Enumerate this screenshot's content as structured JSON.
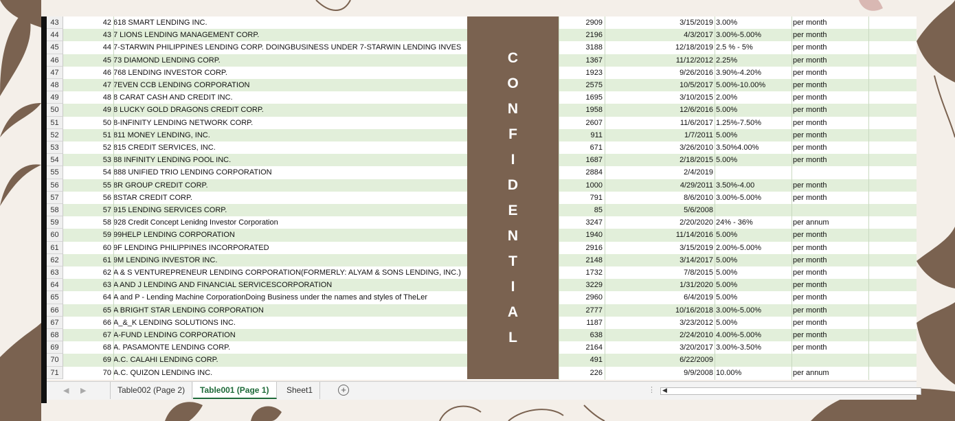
{
  "conf_letters": [
    "C",
    "O",
    "N",
    "F",
    "I",
    "D",
    "E",
    "N",
    "T",
    "I",
    "A",
    "L"
  ],
  "rows": [
    {
      "r": "43",
      "i": "42",
      "n": "618 SMART LENDING INC.",
      "c": "2909",
      "d": "3/15/2019",
      "rate": "3.00%",
      "per": "per month"
    },
    {
      "r": "44",
      "i": "43",
      "n": "7 LIONS LENDING MANAGEMENT CORP.",
      "c": "2196",
      "d": "4/3/2017",
      "rate": "3.00%-5.00%",
      "per": "per month"
    },
    {
      "r": "45",
      "i": "44",
      "n": "7-STARWIN PHILIPPINES LENDING CORP. DOINGBUSINESS UNDER 7-STARWIN LENDING INVES",
      "c": "3188",
      "d": "12/18/2019",
      "rate": "2.5 % - 5%",
      "per": "per month"
    },
    {
      "r": "46",
      "i": "45",
      "n": "73 DIAMOND LENDING CORP.",
      "c": "1367",
      "d": "11/12/2012",
      "rate": "2.25%",
      "per": "per month"
    },
    {
      "r": "47",
      "i": "46",
      "n": "768 LENDING INVESTOR CORP.",
      "c": "1923",
      "d": "9/26/2016",
      "rate": "3.90%-4.20%",
      "per": "per month"
    },
    {
      "r": "48",
      "i": "47",
      "n": "7EVEN CCB LENDING CORPORATION",
      "c": "2575",
      "d": "10/5/2017",
      "rate": "5.00%-10.00%",
      "per": "per month"
    },
    {
      "r": "49",
      "i": "48",
      "n": "8 CARAT CASH AND CREDIT INC.",
      "c": "1695",
      "d": "3/10/2015",
      "rate": "2.00%",
      "per": "per month"
    },
    {
      "r": "50",
      "i": "49",
      "n": "8 LUCKY GOLD DRAGONS CREDIT CORP.",
      "c": "1958",
      "d": "12/6/2016",
      "rate": "5.00%",
      "per": "per month"
    },
    {
      "r": "51",
      "i": "50",
      "n": "8-INFINITY LENDING NETWORK CORP.",
      "c": "2607",
      "d": "11/6/2017",
      "rate": "1.25%-7.50%",
      "per": "per month"
    },
    {
      "r": "52",
      "i": "51",
      "n": "811 MONEY LENDING, INC.",
      "c": "911",
      "d": "1/7/2011",
      "rate": "5.00%",
      "per": "per month"
    },
    {
      "r": "53",
      "i": "52",
      "n": "815 CREDIT SERVICES, INC.",
      "c": "671",
      "d": "3/26/2010",
      "rate": "3.50%4.00%",
      "per": "per month"
    },
    {
      "r": "54",
      "i": "53",
      "n": "88 INFINITY LENDING POOL INC.",
      "c": "1687",
      "d": "2/18/2015",
      "rate": "5.00%",
      "per": "per month"
    },
    {
      "r": "55",
      "i": "54",
      "n": "888 UNIFIED TRIO LENDING CORPORATION",
      "c": "2884",
      "d": "2/4/2019",
      "rate": "",
      "per": ""
    },
    {
      "r": "56",
      "i": "55",
      "n": "8R GROUP CREDIT CORP.",
      "c": "1000",
      "d": "4/29/2011",
      "rate": "3.50%-4.00",
      "per": "per month"
    },
    {
      "r": "57",
      "i": "56",
      "n": "8STAR CREDIT CORP.",
      "c": "791",
      "d": "8/6/2010",
      "rate": "3.00%-5.00%",
      "per": "per month"
    },
    {
      "r": "58",
      "i": "57",
      "n": "915 LENDING SERVICES CORP.",
      "c": "85",
      "d": "5/6/2008",
      "rate": "",
      "per": ""
    },
    {
      "r": "59",
      "i": "58",
      "n": "928 Credit Concept Lenidng Investor Corporation",
      "c": "3247",
      "d": "2/20/2020",
      "rate": "24% - 36%",
      "per": "per annum"
    },
    {
      "r": "60",
      "i": "59",
      "n": "99HELP LENDING CORPORATION",
      "c": "1940",
      "d": "11/14/2016",
      "rate": "5.00%",
      "per": "per month"
    },
    {
      "r": "61",
      "i": "60",
      "n": "9F LENDING PHILIPPINES INCORPORATED",
      "c": "2916",
      "d": "3/15/2019",
      "rate": "2.00%-5.00%",
      "per": "per month"
    },
    {
      "r": "62",
      "i": "61",
      "n": "9M LENDING INVESTOR INC.",
      "c": "2148",
      "d": "3/14/2017",
      "rate": "5.00%",
      "per": "per month"
    },
    {
      "r": "63",
      "i": "62",
      "n": "A & S VENTUREPRENEUR LENDING CORPORATION(FORMERLY: ALYAM & SONS LENDING, INC.)",
      "c": "1732",
      "d": "7/8/2015",
      "rate": "5.00%",
      "per": "per month"
    },
    {
      "r": "64",
      "i": "63",
      "n": "A AND J LENDING AND FINANCIAL SERVICESCORPORATION",
      "c": "3229",
      "d": "1/31/2020",
      "rate": "5.00%",
      "per": "per month"
    },
    {
      "r": "65",
      "i": "64",
      "n": "A and P - Lending Machine CorporationDoing Business under the names and styles of TheLer",
      "c": "2960",
      "d": "6/4/2019",
      "rate": "5.00%",
      "per": "per month"
    },
    {
      "r": "66",
      "i": "65",
      "n": "A BRIGHT STAR LENDING CORPORATION",
      "c": "2777",
      "d": "10/16/2018",
      "rate": "3.00%-5.00%",
      "per": "per month"
    },
    {
      "r": "67",
      "i": "66",
      "n": "A_&_K LENDING SOLUTIONS INC.",
      "c": "1187",
      "d": "3/23/2012",
      "rate": "5.00%",
      "per": "per month"
    },
    {
      "r": "68",
      "i": "67",
      "n": "A-FUND LENDING CORPORATION",
      "c": "638",
      "d": "2/24/2010",
      "rate": "4.00%-5.00%",
      "per": "per month"
    },
    {
      "r": "69",
      "i": "68",
      "n": "A. PASAMONTE LENDING CORP.",
      "c": "2164",
      "d": "3/20/2017",
      "rate": "3.00%-3.50%",
      "per": "per month"
    },
    {
      "r": "70",
      "i": "69",
      "n": "A.C. CALAHI LENDING CORP.",
      "c": "491",
      "d": "6/22/2009",
      "rate": "",
      "per": ""
    },
    {
      "r": "71",
      "i": "70",
      "n": "A.C. QUIZON LENDING INC.",
      "c": "226",
      "d": "9/9/2008",
      "rate": "10.00%",
      "per": "per annum"
    }
  ],
  "tabs": {
    "tab1": "Table002 (Page 2)",
    "tab2": "Table001 (Page 1)",
    "tab3": "Sheet1",
    "add": "+"
  },
  "nav": {
    "prev": "◀",
    "next": "▶"
  },
  "colors": {
    "stripe": "#e2efda",
    "conf_band": "#7a6250",
    "active_tab": "#1e6a39"
  }
}
